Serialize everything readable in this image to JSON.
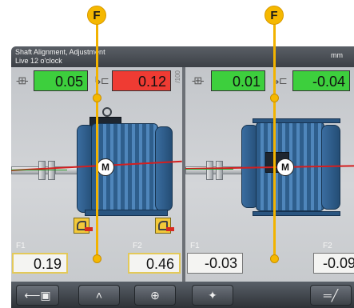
{
  "callouts": [
    {
      "label": "F"
    },
    {
      "label": "F"
    }
  ],
  "window": {
    "title": "Shaft Alignment, Adjustment",
    "subtitle": "Live 12 o'clock",
    "unit": "mm"
  },
  "left_panel": {
    "top_values": [
      {
        "value": "0.05",
        "status": "green",
        "icon": "vertical-offset-icon"
      },
      {
        "value": "0.12",
        "status": "red",
        "icon": "vertical-angle-icon"
      }
    ],
    "scale_label": "/100",
    "motor_label": "M",
    "feet": [
      {
        "label": "F1",
        "value": "0.19"
      },
      {
        "label": "F2",
        "value": "0.46"
      }
    ]
  },
  "right_panel": {
    "top_values": [
      {
        "value": "0.01",
        "status": "green",
        "icon": "horizontal-offset-icon"
      },
      {
        "value": "-0.04",
        "status": "green",
        "icon": "horizontal-angle-icon"
      }
    ],
    "motor_label": "M",
    "feet": [
      {
        "label": "F1",
        "value": "-0.03"
      },
      {
        "label": "F2",
        "value": "-0.09"
      }
    ]
  },
  "toolbar": {
    "buttons": [
      {
        "icon": "machine-shaft-icon",
        "glyph": "⟵▣"
      },
      {
        "icon": "double-chevron-up-icon",
        "glyph": "˄"
      },
      {
        "icon": "add-measurement-icon",
        "glyph": "⊕"
      },
      {
        "icon": "move-directions-icon",
        "glyph": "✦"
      },
      {
        "icon": "shim-adjust-icon",
        "glyph": "═╱"
      }
    ]
  },
  "colors": {
    "callout": "#f5b800",
    "in_tolerance": "#3dcf3d",
    "out_of_tolerance": "#ef3b33",
    "motor": "#3a6da0"
  }
}
